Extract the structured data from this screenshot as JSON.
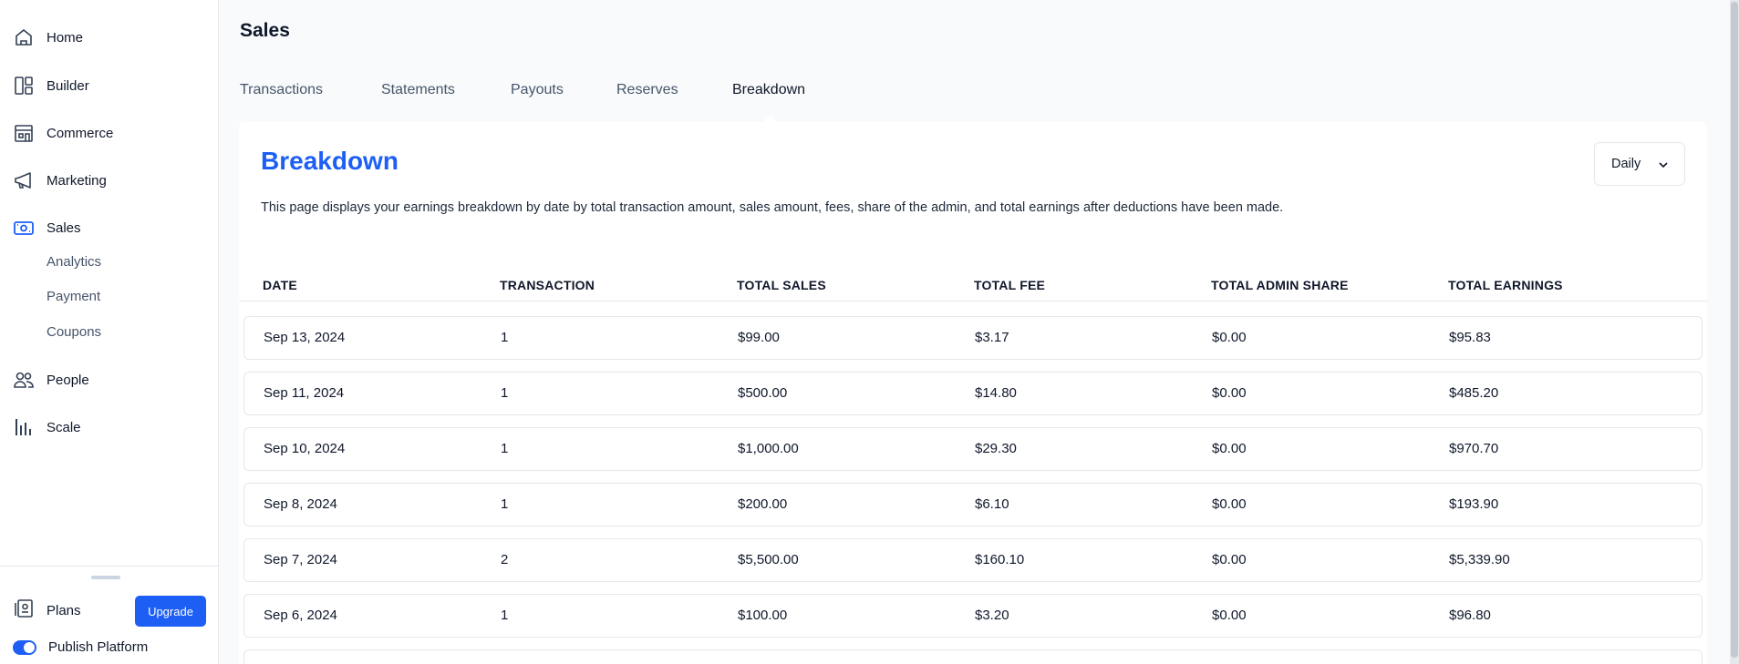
{
  "sidebar": {
    "items": [
      {
        "label": "Home",
        "icon": "home-icon"
      },
      {
        "label": "Builder",
        "icon": "builder-icon"
      },
      {
        "label": "Commerce",
        "icon": "store-icon"
      },
      {
        "label": "Marketing",
        "icon": "megaphone-icon"
      },
      {
        "label": "Sales",
        "icon": "cash-icon"
      }
    ],
    "sales_subitems": [
      "Analytics",
      "Payment",
      "Coupons"
    ],
    "items_after": [
      {
        "label": "People",
        "icon": "people-icon"
      },
      {
        "label": "Scale",
        "icon": "chart-bars-icon"
      }
    ],
    "plans_label": "Plans",
    "upgrade_label": "Upgrade",
    "publish_label": "Publish Platform"
  },
  "header": {
    "title": "Sales",
    "tabs": [
      "Transactions",
      "Statements",
      "Payouts",
      "Reserves",
      "Breakdown"
    ],
    "active_tab": "Breakdown"
  },
  "card": {
    "title": "Breakdown",
    "description": "This page displays your earnings breakdown by date by total transaction amount, sales amount, fees, share of the admin, and total earnings after deductions have been made.",
    "period_select": "Daily"
  },
  "table": {
    "columns": [
      "DATE",
      "TRANSACTION",
      "TOTAL SALES",
      "TOTAL FEE",
      "TOTAL ADMIN SHARE",
      "TOTAL EARNINGS"
    ],
    "rows": [
      [
        "Sep 13, 2024",
        "1",
        "$99.00",
        "$3.17",
        "$0.00",
        "$95.83"
      ],
      [
        "Sep 11, 2024",
        "1",
        "$500.00",
        "$14.80",
        "$0.00",
        "$485.20"
      ],
      [
        "Sep 10, 2024",
        "1",
        "$1,000.00",
        "$29.30",
        "$0.00",
        "$970.70"
      ],
      [
        "Sep 8, 2024",
        "1",
        "$200.00",
        "$6.10",
        "$0.00",
        "$193.90"
      ],
      [
        "Sep 7, 2024",
        "2",
        "$5,500.00",
        "$160.10",
        "$0.00",
        "$5,339.90"
      ],
      [
        "Sep 6, 2024",
        "1",
        "$100.00",
        "$3.20",
        "$0.00",
        "$96.80"
      ]
    ]
  },
  "colors": {
    "accent": "#1d5ff5",
    "border": "#e5e7eb",
    "background": "#f8fafc"
  }
}
